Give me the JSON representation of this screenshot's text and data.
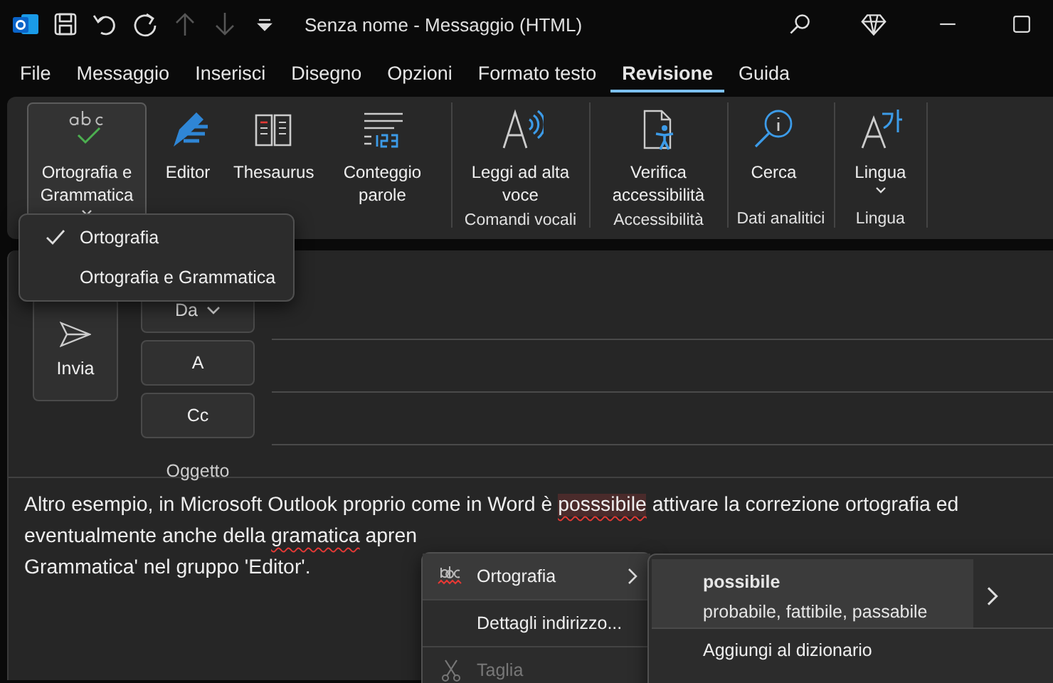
{
  "title_bar": {
    "quick_access": [
      {
        "kind": "save",
        "disabled": false
      },
      {
        "kind": "undo",
        "disabled": false
      },
      {
        "kind": "redo",
        "disabled": false
      },
      {
        "kind": "up",
        "disabled": true
      },
      {
        "kind": "down",
        "disabled": true
      },
      {
        "kind": "customize",
        "disabled": false
      }
    ],
    "title": "Senza nome  -  Messaggio (HTML)"
  },
  "tabs": [
    {
      "label": "File",
      "selected": false
    },
    {
      "label": "Messaggio",
      "selected": false
    },
    {
      "label": "Inserisci",
      "selected": false
    },
    {
      "label": "Disegno",
      "selected": false
    },
    {
      "label": "Opzioni",
      "selected": false
    },
    {
      "label": "Formato testo",
      "selected": false
    },
    {
      "label": "Revisione",
      "selected": true
    },
    {
      "label": "Guida",
      "selected": false
    }
  ],
  "ribbon": {
    "groups": [
      {
        "buttons": [
          {
            "kind": "spelling",
            "label": "Ortografia e Grammatica",
            "dropdown": true,
            "expanded": true
          },
          {
            "kind": "editor",
            "label": "Editor",
            "dropdown": false,
            "expanded": false
          },
          {
            "kind": "thesaurus",
            "label": "Thesaurus",
            "dropdown": false,
            "expanded": false
          },
          {
            "kind": "wordcount",
            "label": "Conteggio parole",
            "dropdown": false,
            "expanded": false
          }
        ]
      },
      {
        "label": "Comandi vocali",
        "buttons": [
          {
            "kind": "read",
            "label": "Leggi ad alta voce",
            "dropdown": false,
            "expanded": false
          }
        ]
      },
      {
        "label": "Accessibilità",
        "buttons": [
          {
            "kind": "access",
            "label": "Verifica accessibilità",
            "dropdown": false,
            "expanded": false
          }
        ]
      },
      {
        "label": "Dati analitici",
        "buttons": [
          {
            "kind": "search",
            "label": "Cerca",
            "dropdown": false,
            "expanded": false
          }
        ]
      },
      {
        "label": "Lingua",
        "buttons": [
          {
            "kind": "language",
            "label": "Lingua",
            "dropdown": true,
            "expanded": false
          }
        ]
      }
    ]
  },
  "spelling_menu": {
    "items": [
      {
        "label": "Ortografia",
        "checked": true
      },
      {
        "label": "Ortografia e Grammatica",
        "checked": false
      }
    ]
  },
  "compose": {
    "send": "Invia",
    "fields": [
      {
        "label": "Da",
        "dropdown": true
      },
      {
        "label": "A",
        "dropdown": false
      },
      {
        "label": "Cc",
        "dropdown": false
      }
    ],
    "subject_label": "Oggetto"
  },
  "body": {
    "lines": [
      [
        {
          "kind": "plain",
          "text": "Altro esempio, in Microsoft Outlook proprio come in Word è "
        },
        {
          "kind": "misspelled_active",
          "text": "posssibile"
        },
        {
          "kind": "plain",
          "text": " attivare la correzione ortografia ed"
        }
      ],
      [
        {
          "kind": "plain",
          "text": "eventualmente anche della "
        },
        {
          "kind": "misspelled",
          "text": "gramatica"
        },
        {
          "kind": "plain",
          "text": " apren"
        }
      ],
      [
        {
          "kind": "plain",
          "text": "Grammatica' nel gruppo 'Editor'."
        }
      ]
    ]
  },
  "context_menu": {
    "items": [
      {
        "kind": "spelling",
        "label": "Ortografia",
        "highlighted": true,
        "disabled": false
      },
      {
        "kind": "plain",
        "label": "Dettagli indirizzo...",
        "highlighted": false,
        "disabled": false
      },
      {
        "kind": "cut",
        "label": "Taglia",
        "highlighted": false,
        "disabled": true
      }
    ]
  },
  "spelling_submenu": {
    "suggestion": {
      "word": "possibile",
      "alternatives": "probabile, fattibile, passabile"
    },
    "items": [
      "Aggiungi al dizionario"
    ]
  }
}
